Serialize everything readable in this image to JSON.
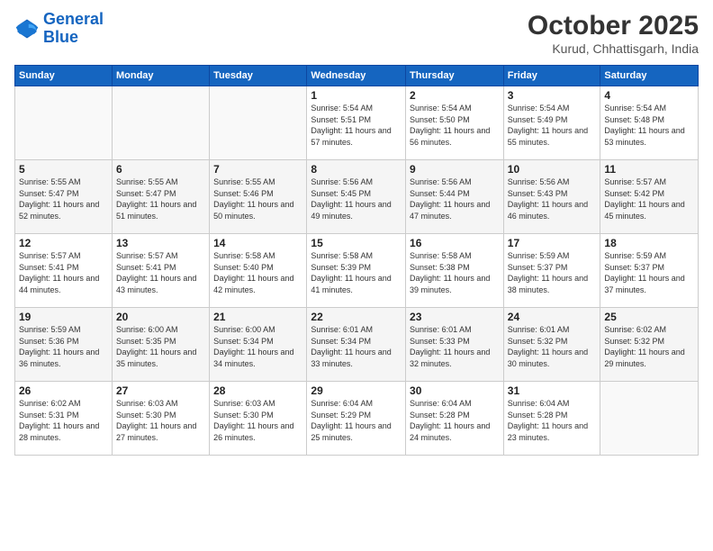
{
  "logo": {
    "line1": "General",
    "line2": "Blue"
  },
  "header": {
    "month": "October 2025",
    "location": "Kurud, Chhattisgarh, India"
  },
  "weekdays": [
    "Sunday",
    "Monday",
    "Tuesday",
    "Wednesday",
    "Thursday",
    "Friday",
    "Saturday"
  ],
  "weeks": [
    [
      {
        "day": "",
        "sunrise": "",
        "sunset": "",
        "daylight": ""
      },
      {
        "day": "",
        "sunrise": "",
        "sunset": "",
        "daylight": ""
      },
      {
        "day": "",
        "sunrise": "",
        "sunset": "",
        "daylight": ""
      },
      {
        "day": "1",
        "sunrise": "Sunrise: 5:54 AM",
        "sunset": "Sunset: 5:51 PM",
        "daylight": "Daylight: 11 hours and 57 minutes."
      },
      {
        "day": "2",
        "sunrise": "Sunrise: 5:54 AM",
        "sunset": "Sunset: 5:50 PM",
        "daylight": "Daylight: 11 hours and 56 minutes."
      },
      {
        "day": "3",
        "sunrise": "Sunrise: 5:54 AM",
        "sunset": "Sunset: 5:49 PM",
        "daylight": "Daylight: 11 hours and 55 minutes."
      },
      {
        "day": "4",
        "sunrise": "Sunrise: 5:54 AM",
        "sunset": "Sunset: 5:48 PM",
        "daylight": "Daylight: 11 hours and 53 minutes."
      }
    ],
    [
      {
        "day": "5",
        "sunrise": "Sunrise: 5:55 AM",
        "sunset": "Sunset: 5:47 PM",
        "daylight": "Daylight: 11 hours and 52 minutes."
      },
      {
        "day": "6",
        "sunrise": "Sunrise: 5:55 AM",
        "sunset": "Sunset: 5:47 PM",
        "daylight": "Daylight: 11 hours and 51 minutes."
      },
      {
        "day": "7",
        "sunrise": "Sunrise: 5:55 AM",
        "sunset": "Sunset: 5:46 PM",
        "daylight": "Daylight: 11 hours and 50 minutes."
      },
      {
        "day": "8",
        "sunrise": "Sunrise: 5:56 AM",
        "sunset": "Sunset: 5:45 PM",
        "daylight": "Daylight: 11 hours and 49 minutes."
      },
      {
        "day": "9",
        "sunrise": "Sunrise: 5:56 AM",
        "sunset": "Sunset: 5:44 PM",
        "daylight": "Daylight: 11 hours and 47 minutes."
      },
      {
        "day": "10",
        "sunrise": "Sunrise: 5:56 AM",
        "sunset": "Sunset: 5:43 PM",
        "daylight": "Daylight: 11 hours and 46 minutes."
      },
      {
        "day": "11",
        "sunrise": "Sunrise: 5:57 AM",
        "sunset": "Sunset: 5:42 PM",
        "daylight": "Daylight: 11 hours and 45 minutes."
      }
    ],
    [
      {
        "day": "12",
        "sunrise": "Sunrise: 5:57 AM",
        "sunset": "Sunset: 5:41 PM",
        "daylight": "Daylight: 11 hours and 44 minutes."
      },
      {
        "day": "13",
        "sunrise": "Sunrise: 5:57 AM",
        "sunset": "Sunset: 5:41 PM",
        "daylight": "Daylight: 11 hours and 43 minutes."
      },
      {
        "day": "14",
        "sunrise": "Sunrise: 5:58 AM",
        "sunset": "Sunset: 5:40 PM",
        "daylight": "Daylight: 11 hours and 42 minutes."
      },
      {
        "day": "15",
        "sunrise": "Sunrise: 5:58 AM",
        "sunset": "Sunset: 5:39 PM",
        "daylight": "Daylight: 11 hours and 41 minutes."
      },
      {
        "day": "16",
        "sunrise": "Sunrise: 5:58 AM",
        "sunset": "Sunset: 5:38 PM",
        "daylight": "Daylight: 11 hours and 39 minutes."
      },
      {
        "day": "17",
        "sunrise": "Sunrise: 5:59 AM",
        "sunset": "Sunset: 5:37 PM",
        "daylight": "Daylight: 11 hours and 38 minutes."
      },
      {
        "day": "18",
        "sunrise": "Sunrise: 5:59 AM",
        "sunset": "Sunset: 5:37 PM",
        "daylight": "Daylight: 11 hours and 37 minutes."
      }
    ],
    [
      {
        "day": "19",
        "sunrise": "Sunrise: 5:59 AM",
        "sunset": "Sunset: 5:36 PM",
        "daylight": "Daylight: 11 hours and 36 minutes."
      },
      {
        "day": "20",
        "sunrise": "Sunrise: 6:00 AM",
        "sunset": "Sunset: 5:35 PM",
        "daylight": "Daylight: 11 hours and 35 minutes."
      },
      {
        "day": "21",
        "sunrise": "Sunrise: 6:00 AM",
        "sunset": "Sunset: 5:34 PM",
        "daylight": "Daylight: 11 hours and 34 minutes."
      },
      {
        "day": "22",
        "sunrise": "Sunrise: 6:01 AM",
        "sunset": "Sunset: 5:34 PM",
        "daylight": "Daylight: 11 hours and 33 minutes."
      },
      {
        "day": "23",
        "sunrise": "Sunrise: 6:01 AM",
        "sunset": "Sunset: 5:33 PM",
        "daylight": "Daylight: 11 hours and 32 minutes."
      },
      {
        "day": "24",
        "sunrise": "Sunrise: 6:01 AM",
        "sunset": "Sunset: 5:32 PM",
        "daylight": "Daylight: 11 hours and 30 minutes."
      },
      {
        "day": "25",
        "sunrise": "Sunrise: 6:02 AM",
        "sunset": "Sunset: 5:32 PM",
        "daylight": "Daylight: 11 hours and 29 minutes."
      }
    ],
    [
      {
        "day": "26",
        "sunrise": "Sunrise: 6:02 AM",
        "sunset": "Sunset: 5:31 PM",
        "daylight": "Daylight: 11 hours and 28 minutes."
      },
      {
        "day": "27",
        "sunrise": "Sunrise: 6:03 AM",
        "sunset": "Sunset: 5:30 PM",
        "daylight": "Daylight: 11 hours and 27 minutes."
      },
      {
        "day": "28",
        "sunrise": "Sunrise: 6:03 AM",
        "sunset": "Sunset: 5:30 PM",
        "daylight": "Daylight: 11 hours and 26 minutes."
      },
      {
        "day": "29",
        "sunrise": "Sunrise: 6:04 AM",
        "sunset": "Sunset: 5:29 PM",
        "daylight": "Daylight: 11 hours and 25 minutes."
      },
      {
        "day": "30",
        "sunrise": "Sunrise: 6:04 AM",
        "sunset": "Sunset: 5:28 PM",
        "daylight": "Daylight: 11 hours and 24 minutes."
      },
      {
        "day": "31",
        "sunrise": "Sunrise: 6:04 AM",
        "sunset": "Sunset: 5:28 PM",
        "daylight": "Daylight: 11 hours and 23 minutes."
      },
      {
        "day": "",
        "sunrise": "",
        "sunset": "",
        "daylight": ""
      }
    ]
  ]
}
